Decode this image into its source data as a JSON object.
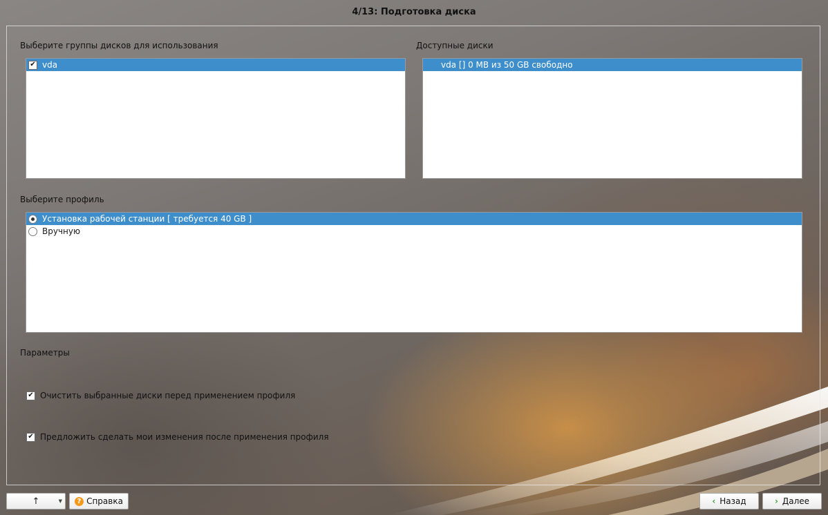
{
  "window": {
    "title": "4/13: Подготовка диска"
  },
  "disk_groups": {
    "label": "Выберите группы дисков для использования",
    "items": [
      {
        "label": "vda",
        "checked": true,
        "selected": true
      }
    ]
  },
  "available_disks": {
    "label": "Доступные диски",
    "items": [
      {
        "label": "vda []  0 MB из 50 GB свободно",
        "selected": true
      }
    ]
  },
  "profile": {
    "label": "Выберите профиль",
    "options": [
      {
        "label": "Установка рабочей станции [ требуется 40 GB ]",
        "checked": true,
        "selected": true
      },
      {
        "label": "Вручную",
        "checked": false,
        "selected": false
      }
    ]
  },
  "parameters": {
    "label": "Параметры",
    "options": [
      {
        "label": "Очистить выбранные диски перед применением профиля",
        "checked": true
      },
      {
        "label": "Предложить сделать мои изменения после применения профиля",
        "checked": true
      }
    ]
  },
  "footer": {
    "up_button_icon": "arrow-up-icon",
    "up_button_symbol": "↑",
    "dropdown_symbol": "▼",
    "help_label": "Справка",
    "help_icon_symbol": "?",
    "back_label": "Назад",
    "back_symbol": "‹",
    "next_label": "Далее",
    "next_symbol": "›"
  },
  "colors": {
    "selection": "#3d8ecb",
    "help_icon": "#f39a1d",
    "nav_chevron": "#3aa634"
  }
}
